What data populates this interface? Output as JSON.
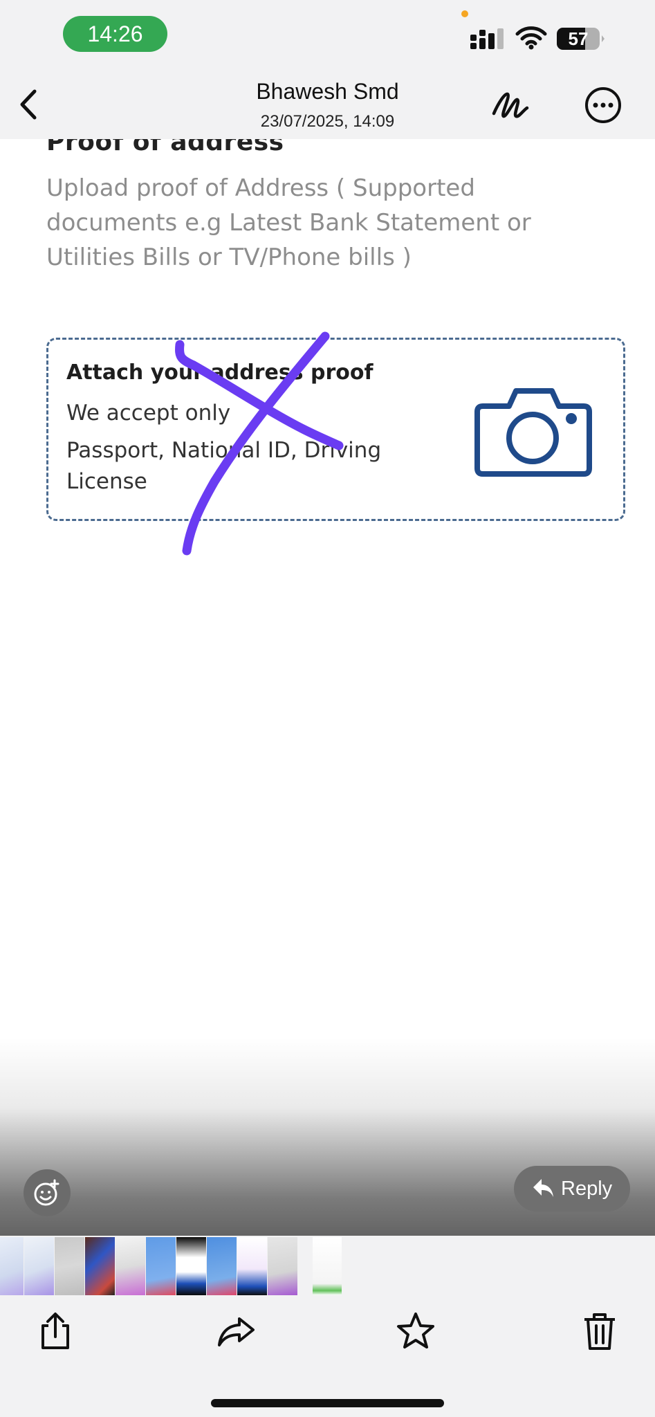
{
  "status_bar": {
    "time": "14:26",
    "battery_level": "57",
    "icons": [
      "signal-icon",
      "wifi-icon",
      "battery-icon"
    ]
  },
  "header": {
    "title": "Bhawesh Smd",
    "subtitle": "23/07/2025, 14:09",
    "icons": [
      "back-chevron-icon",
      "markup-pen-icon",
      "more-ellipsis-icon"
    ]
  },
  "document": {
    "heading": "Proof of address",
    "description": "Upload proof of Address ( Supported documents e.g Latest Bank Statement or Utilities Bills or TV/Phone bills )",
    "upload_box": {
      "title": "Attach your address proof",
      "note": "We accept only",
      "accepted_docs": "Passport, National ID, Driving License",
      "icon": "camera-icon"
    },
    "annotation_color": "#6a3cf2"
  },
  "overlay": {
    "reply_label": "Reply",
    "icons": [
      "add-reaction-icon",
      "reply-arrow-icon"
    ]
  },
  "thumbnails": {
    "count": 11
  },
  "toolbar": {
    "icons": [
      "share-icon",
      "forward-icon",
      "star-icon",
      "trash-icon"
    ]
  },
  "colors": {
    "accent_green": "#34a853",
    "brand_blue": "#1f4a8a"
  }
}
